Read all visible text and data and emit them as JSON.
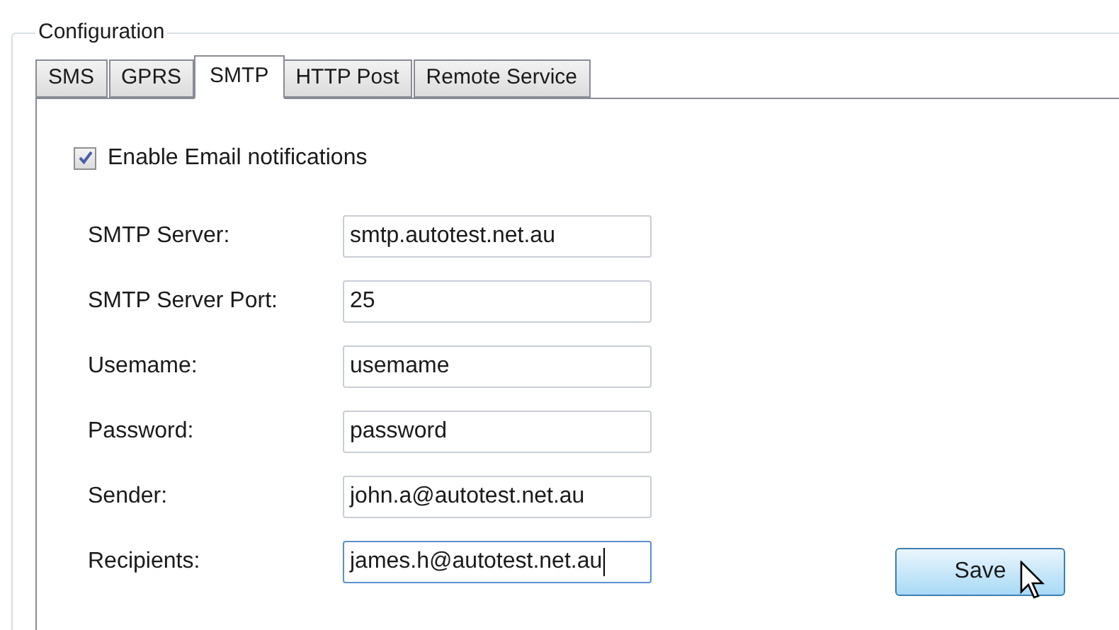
{
  "group": {
    "title": "Configuration"
  },
  "tabs": [
    {
      "label": "SMS",
      "selected": false
    },
    {
      "label": "GPRS",
      "selected": false
    },
    {
      "label": "SMTP",
      "selected": true
    },
    {
      "label": "HTTP Post",
      "selected": false
    },
    {
      "label": "Remote Service",
      "selected": false
    }
  ],
  "enable_checkbox": {
    "label": "Enable Email notifications",
    "checked": true
  },
  "fields": [
    {
      "label": "SMTP Server:",
      "value": "smtp.autotest.net.au",
      "focused": false
    },
    {
      "label": "SMTP Server Port:",
      "value": "25",
      "focused": false
    },
    {
      "label": "Usemame:",
      "value": "usemame",
      "focused": false
    },
    {
      "label": "Password:",
      "value": "password",
      "focused": false
    },
    {
      "label": "Sender:",
      "value": "john.a@autotest.net.au",
      "focused": false
    },
    {
      "label": "Recipients:",
      "value": "james.h@autotest.net.au",
      "focused": true
    }
  ],
  "save_button": {
    "label": "Save"
  }
}
